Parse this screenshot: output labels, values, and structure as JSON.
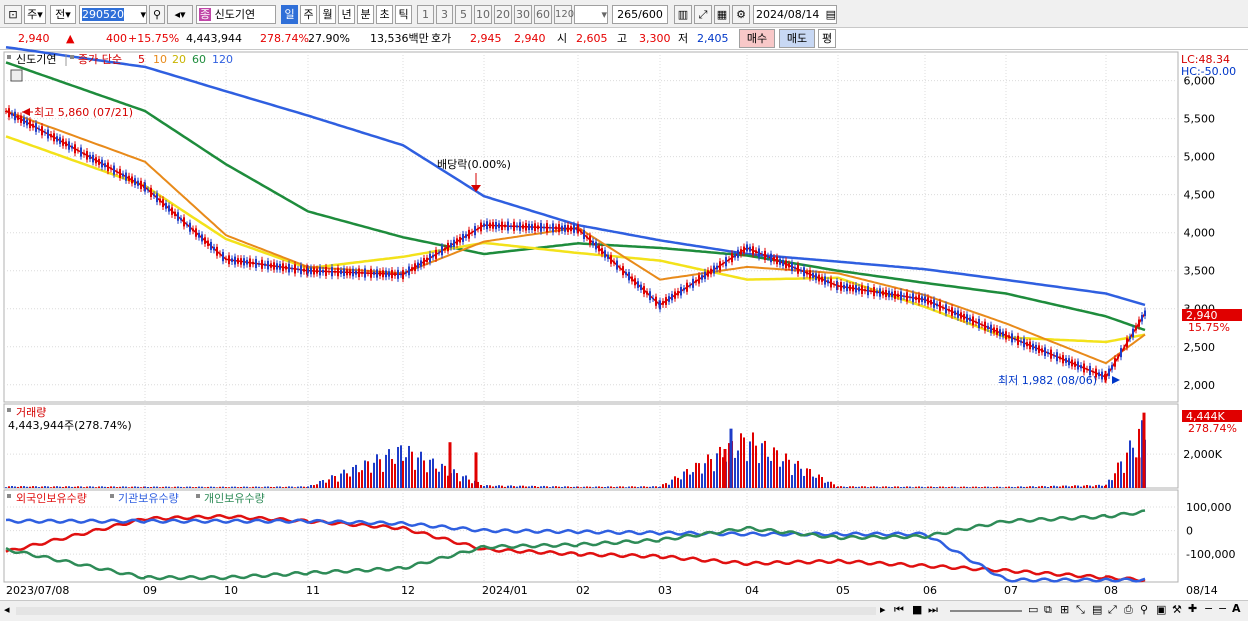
{
  "toolbar": {
    "type_label": "주",
    "prev_label": "전",
    "code_value": "290520",
    "stock_name": "신도기연",
    "period_tabs": [
      "일",
      "주",
      "월",
      "년",
      "분",
      "초",
      "틱"
    ],
    "interval_tabs": [
      "1",
      "3",
      "5",
      "10",
      "20",
      "30",
      "60",
      "120"
    ],
    "count_value": "265",
    "count_total": "/600",
    "date_value": "2024/08/14"
  },
  "quote": {
    "price": "2,940",
    "change": "400",
    "change_pct": "+15.75%",
    "volume": "4,443,944",
    "volume_ratio": "278.74%",
    "turnover": "27.90%",
    "amount": "13,536백만",
    "ask_label": "호가",
    "ask_value": "2,945",
    "bid_value": "2,940",
    "open_label": "시",
    "open_value": "2,605",
    "high_label": "고",
    "high_value": "3,300",
    "low_label": "저",
    "low_value": "2,405",
    "buy_label": "매수",
    "sell_label": "매도",
    "eval_label": "평"
  },
  "price_panel": {
    "stock_tag": "신도기연",
    "ma_title": "종가 단순",
    "ma_labels": [
      "5",
      "10",
      "20",
      "60",
      "120"
    ],
    "ma_colors": [
      "#d40000",
      "#e88a1a",
      "#f3e21a",
      "#1e8c3c",
      "#2f5fe0"
    ],
    "lc": "LC:48.34",
    "hc": "HC:-50.00",
    "max_note": "최고 5,860 (07/21)",
    "min_note": "최저 1,982 (08/06)",
    "div_note": "배당락(0.00%)",
    "last_price": "2,940",
    "last_pct": "15.75%"
  },
  "volume_panel": {
    "title": "거래량",
    "value": "4,443,944주(278.74%)",
    "last_label": "4,444K",
    "last_pct": "278.74%"
  },
  "holding_panel": {
    "labels": [
      "외국인보유수량",
      "기관보유수량",
      "개인보유수량"
    ],
    "colors": [
      "#e01010",
      "#2f5fe0",
      "#2e8b57"
    ]
  },
  "chart_data": [
    {
      "type": "line",
      "title": "신도기연 종가 단순 5 10 20 60 120",
      "x_ticks": [
        "2023/07/08",
        "09",
        "10",
        "11",
        "12",
        "2024/01",
        "02",
        "03",
        "04",
        "05",
        "06",
        "07",
        "08",
        "08/14"
      ],
      "y_ticks": [
        2000,
        2500,
        3000,
        3500,
        4000,
        4500,
        5000,
        5500,
        6000
      ],
      "ylim": [
        1800,
        6350
      ],
      "series": [
        {
          "name": "120",
          "x": [
            "2023/07/08",
            "09",
            "10",
            "11",
            "12",
            "2024/01",
            "02",
            "03",
            "04",
            "05",
            "06",
            "07",
            "08",
            "08/14"
          ],
          "values": [
            6440,
            6180,
            5860,
            5540,
            5150,
            4480,
            4100,
            3900,
            3720,
            3620,
            3520,
            3380,
            3200,
            3050
          ]
        },
        {
          "name": "60",
          "x": [
            "2023/07/08",
            "09",
            "10",
            "11",
            "12",
            "2024/01",
            "02",
            "03",
            "04",
            "05",
            "06",
            "07",
            "08",
            "08/14"
          ],
          "values": [
            6240,
            5600,
            4900,
            4280,
            3940,
            3720,
            3860,
            3800,
            3700,
            3500,
            3340,
            3200,
            2900,
            2720
          ]
        },
        {
          "name": "close",
          "x": [
            "2023/07/08",
            "09",
            "10",
            "11",
            "12",
            "2024/01",
            "02",
            "03",
            "04",
            "05",
            "06",
            "07",
            "08",
            "08/14"
          ],
          "values": [
            5600,
            4600,
            3650,
            3500,
            3450,
            4100,
            4050,
            3050,
            3800,
            3300,
            3120,
            2650,
            2100,
            2940
          ]
        }
      ]
    },
    {
      "type": "bar",
      "title": "거래량",
      "y_ticks": [
        2000
      ],
      "ylim": [
        0,
        4600
      ],
      "series": [
        {
          "name": "거래량",
          "x": [
            "2023/07/08",
            "09",
            "10",
            "11",
            "12",
            "2024/01",
            "02",
            "03",
            "04",
            "05",
            "06",
            "07",
            "08",
            "08/14"
          ],
          "values": [
            120,
            90,
            80,
            100,
            2700,
            180,
            90,
            110,
            3500,
            110,
            90,
            80,
            200,
            4444
          ]
        }
      ]
    },
    {
      "type": "line",
      "title": "외국인보유수량 기관보유수량 개인보유수량",
      "y_ticks": [
        -100000,
        0,
        100000
      ],
      "ylim": [
        -210000,
        130000
      ],
      "series": [
        {
          "name": "외국인보유수량",
          "x": [
            "2023/07/08",
            "09",
            "10",
            "11",
            "12",
            "2024/01",
            "02",
            "03",
            "04",
            "05",
            "06",
            "07",
            "08",
            "08/14"
          ],
          "values": [
            -90000,
            50000,
            60000,
            40000,
            10000,
            -80000,
            -100000,
            -110000,
            -140000,
            -130000,
            -150000,
            -170000,
            -200000,
            -210000
          ]
        },
        {
          "name": "기관보유수량",
          "x": [
            "2023/07/08",
            "09",
            "10",
            "11",
            "12",
            "2024/01",
            "02",
            "03",
            "04",
            "05",
            "06",
            "07",
            "08",
            "08/14"
          ],
          "values": [
            40000,
            40000,
            40000,
            40000,
            30000,
            0,
            -5000,
            -10000,
            -15000,
            -15000,
            -15000,
            -210000,
            -210000,
            -210000
          ]
        },
        {
          "name": "개인보유수량",
          "x": [
            "2023/07/08",
            "09",
            "10",
            "11",
            "12",
            "2024/01",
            "02",
            "03",
            "04",
            "05",
            "06",
            "07",
            "08",
            "08/14"
          ],
          "values": [
            -80000,
            -200000,
            -200000,
            -180000,
            -160000,
            -70000,
            -60000,
            -40000,
            10000,
            -30000,
            -25000,
            40000,
            60000,
            80000
          ]
        }
      ]
    }
  ]
}
